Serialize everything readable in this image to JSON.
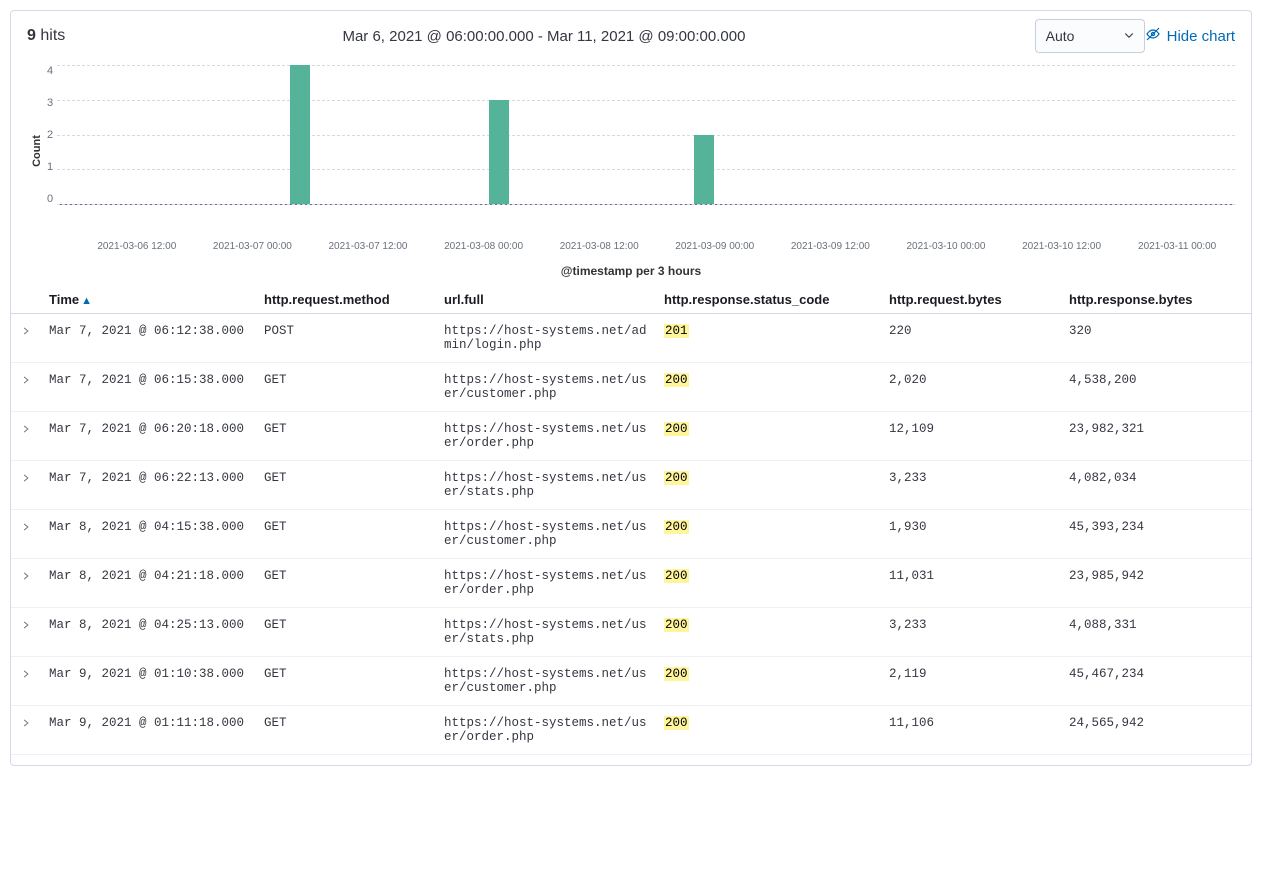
{
  "header": {
    "hits_count": "9",
    "hits_label": "hits",
    "time_range": "Mar 6, 2021 @ 06:00:00.000 - Mar 11, 2021 @ 09:00:00.000",
    "interval_selected": "Auto",
    "hide_chart_label": "Hide chart"
  },
  "chart_data": {
    "type": "bar",
    "ylabel": "Count",
    "xlabel": "@timestamp per 3 hours",
    "ylim": [
      0,
      4
    ],
    "y_ticks": [
      "4",
      "3",
      "2",
      "1",
      "0"
    ],
    "x_ticks": [
      "2021-03-06 12:00",
      "2021-03-07 00:00",
      "2021-03-07 12:00",
      "2021-03-08 00:00",
      "2021-03-08 12:00",
      "2021-03-09 00:00",
      "2021-03-09 12:00",
      "2021-03-10 00:00",
      "2021-03-10 12:00",
      "2021-03-11 00:00"
    ],
    "bars": [
      {
        "x_pct": 19.8,
        "value": 4
      },
      {
        "x_pct": 36.7,
        "value": 3
      },
      {
        "x_pct": 54.1,
        "value": 2
      }
    ],
    "bar_color": "#54b399"
  },
  "table": {
    "columns": {
      "time": "Time",
      "method": "http.request.method",
      "url": "url.full",
      "status": "http.response.status_code",
      "req_bytes": "http.request.bytes",
      "resp_bytes": "http.response.bytes"
    },
    "rows": [
      {
        "time": "Mar 7, 2021 @ 06:12:38.000",
        "method": "POST",
        "url": "https://host-systems.net/admin/login.php",
        "status": "201",
        "req_bytes": "220",
        "resp_bytes": "320"
      },
      {
        "time": "Mar 7, 2021 @ 06:15:38.000",
        "method": "GET",
        "url": "https://host-systems.net/user/customer.php",
        "status": "200",
        "req_bytes": "2,020",
        "resp_bytes": "4,538,200"
      },
      {
        "time": "Mar 7, 2021 @ 06:20:18.000",
        "method": "GET",
        "url": "https://host-systems.net/user/order.php",
        "status": "200",
        "req_bytes": "12,109",
        "resp_bytes": "23,982,321"
      },
      {
        "time": "Mar 7, 2021 @ 06:22:13.000",
        "method": "GET",
        "url": "https://host-systems.net/user/stats.php",
        "status": "200",
        "req_bytes": "3,233",
        "resp_bytes": "4,082,034"
      },
      {
        "time": "Mar 8, 2021 @ 04:15:38.000",
        "method": "GET",
        "url": "https://host-systems.net/user/customer.php",
        "status": "200",
        "req_bytes": "1,930",
        "resp_bytes": "45,393,234"
      },
      {
        "time": "Mar 8, 2021 @ 04:21:18.000",
        "method": "GET",
        "url": "https://host-systems.net/user/order.php",
        "status": "200",
        "req_bytes": "11,031",
        "resp_bytes": "23,985,942"
      },
      {
        "time": "Mar 8, 2021 @ 04:25:13.000",
        "method": "GET",
        "url": "https://host-systems.net/user/stats.php",
        "status": "200",
        "req_bytes": "3,233",
        "resp_bytes": "4,088,331"
      },
      {
        "time": "Mar 9, 2021 @ 01:10:38.000",
        "method": "GET",
        "url": "https://host-systems.net/user/customer.php",
        "status": "200",
        "req_bytes": "2,119",
        "resp_bytes": "45,467,234"
      },
      {
        "time": "Mar 9, 2021 @ 01:11:18.000",
        "method": "GET",
        "url": "https://host-systems.net/user/order.php",
        "status": "200",
        "req_bytes": "11,106",
        "resp_bytes": "24,565,942"
      }
    ],
    "highlight_column": "status"
  }
}
